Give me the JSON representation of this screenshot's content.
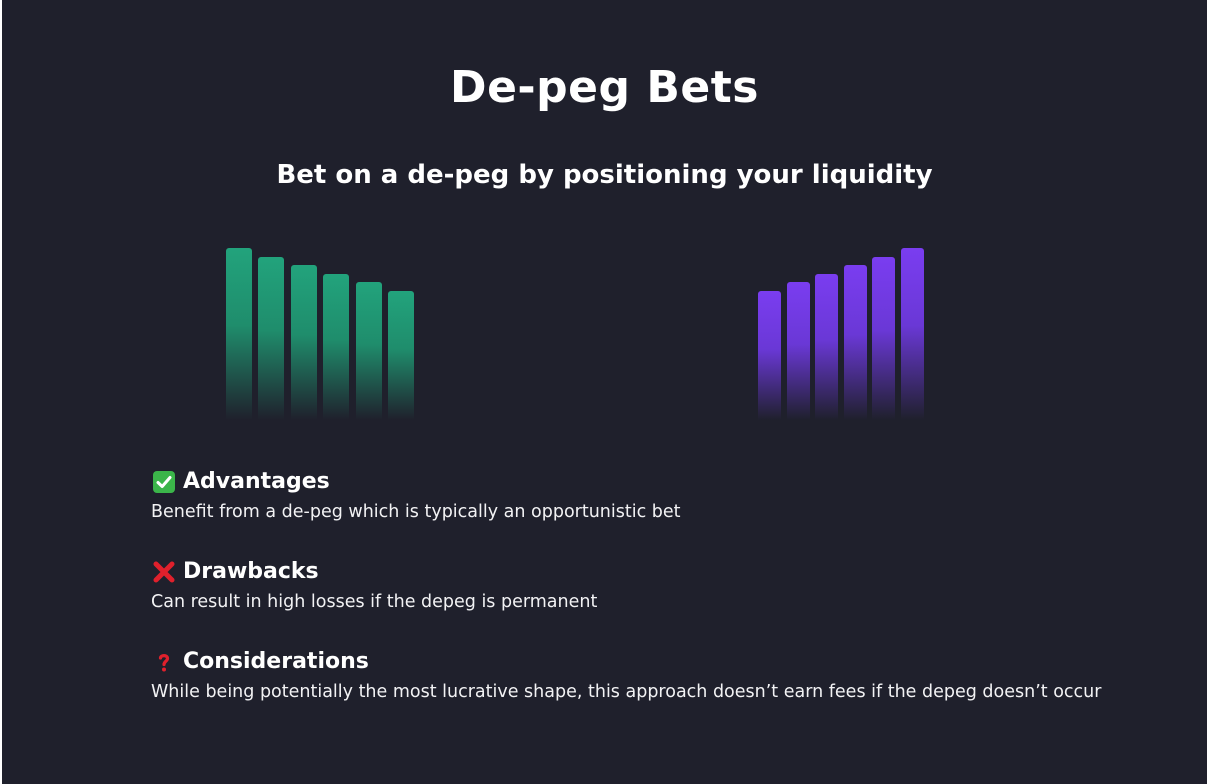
{
  "page": {
    "title": "De-peg Bets",
    "subtitle": "Bet on a de-peg by positioning your liquidity"
  },
  "illustration": {
    "left_shape": {
      "color": "#22a37c",
      "relative_levels": [
        1.0,
        0.95,
        0.9,
        0.85,
        0.8,
        0.75
      ]
    },
    "right_shape": {
      "color": "#7a3df0",
      "relative_levels": [
        0.75,
        0.8,
        0.85,
        0.9,
        0.95,
        1.0
      ]
    }
  },
  "sections": [
    {
      "icon": "check-mark-icon",
      "title": "Advantages",
      "text": "Benefit from a de-peg which is typically an opportunistic bet"
    },
    {
      "icon": "cross-mark-icon",
      "title": "Drawbacks",
      "text": "Can result in high losses if the depeg is permanent"
    },
    {
      "icon": "question-mark-icon",
      "title": "Considerations",
      "text": "While being potentially the most lucrative shape, this approach doesn’t earn fees if the depeg doesn’t occur"
    }
  ],
  "colors": {
    "background": "#1f202c",
    "check": "#3bb54a",
    "cross": "#e0202c",
    "question": "#e0202c"
  }
}
